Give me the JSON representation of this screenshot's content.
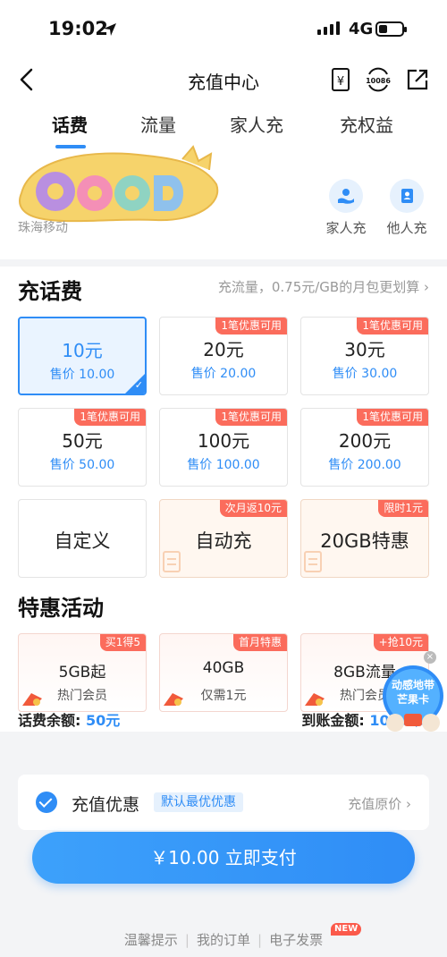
{
  "status_bar": {
    "time": "19:02",
    "network": "4G"
  },
  "nav": {
    "title": "充值中心",
    "yen_icon": "¥",
    "service_icon": "10086"
  },
  "tabs": [
    {
      "label": "话费",
      "active": true
    },
    {
      "label": "流量",
      "active": false
    },
    {
      "label": "家人充",
      "active": false
    },
    {
      "label": "充权益",
      "active": false
    }
  ],
  "header": {
    "sticker_text": "GOOD",
    "carrier": "珠海移动",
    "quick_actions": [
      {
        "label": "家人充",
        "icon": "family-hand-icon"
      },
      {
        "label": "他人充",
        "icon": "contact-book-icon"
      }
    ]
  },
  "recharge": {
    "title": "充话费",
    "flow_tip": "充流量，0.75元/GB的月包更划算",
    "cards": [
      {
        "amount": "10元",
        "price": "售价 10.00",
        "badge": "",
        "selected": true
      },
      {
        "amount": "20元",
        "price": "售价 20.00",
        "badge": "1笔优惠可用",
        "selected": false
      },
      {
        "amount": "30元",
        "price": "售价 30.00",
        "badge": "1笔优惠可用",
        "selected": false
      },
      {
        "amount": "50元",
        "price": "售价 50.00",
        "badge": "1笔优惠可用",
        "selected": false
      },
      {
        "amount": "100元",
        "price": "售价 100.00",
        "badge": "1笔优惠可用",
        "selected": false
      },
      {
        "amount": "200元",
        "price": "售价 200.00",
        "badge": "1笔优惠可用",
        "selected": false
      }
    ],
    "special_cards": [
      {
        "label": "自定义",
        "badge": ""
      },
      {
        "label": "自动充",
        "badge": "次月返10元"
      },
      {
        "label": "20GB特惠",
        "badge": "限时1元"
      }
    ]
  },
  "promotions": {
    "title": "特惠活动",
    "items": [
      {
        "name": "5GB起",
        "sub": "热门会员",
        "badge": "买1得5"
      },
      {
        "name": "40GB",
        "sub": "仅需1元",
        "badge": "首月特惠"
      },
      {
        "name": "8GB流量",
        "sub": "热门会员",
        "badge": "+抢10元"
      }
    ]
  },
  "balance": {
    "left_label": "话费余额: ",
    "left_value": "50元",
    "right_label": "到账金额: ",
    "right_value": "10.00元"
  },
  "discount": {
    "label": "充值优惠",
    "tag": "默认最优优惠",
    "right": "充值原价"
  },
  "pay_button": "￥10.00  立即支付",
  "footer": {
    "tips": "温馨提示",
    "orders": "我的订单",
    "invoice": "电子发票",
    "new_badge": "NEW"
  },
  "float_ad": {
    "line1": "动感地带",
    "line2": "芒果卡"
  },
  "colors": {
    "accent": "#2f8df6",
    "badge_red": "#fb6c5c",
    "background": "#f3f4f6"
  }
}
